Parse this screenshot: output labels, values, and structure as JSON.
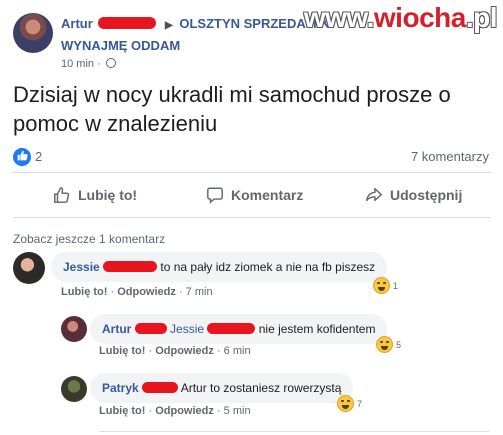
{
  "post": {
    "author": "Artur",
    "group_line1": "OLSZTYN SPRZEDAM K",
    "group_line2": "WYNAJMĘ ODDAM",
    "time": "10 min",
    "text": "Dzisiaj w nocy ukradli mi samochud prosze o pomoc w znalezieniu",
    "like_count": "2",
    "comment_count": "7 komentarzy",
    "watermark_a": "www.",
    "watermark_b": "wiocha",
    "watermark_c": ".pl"
  },
  "actions": {
    "like": "Lubię to!",
    "comment": "Komentarz",
    "share": "Udostępnij"
  },
  "comments_section": {
    "more_link": "Zobacz jeszcze 1 komentarz",
    "items": [
      {
        "author": "Jessie",
        "text": "to na pały idz ziomek a nie na fb piszesz",
        "like": "Lubię to!",
        "reply": "Odpowiedz",
        "time": "7 min",
        "reaction_count": "1"
      },
      {
        "author": "Artur",
        "tagged": "Jessie",
        "text": "nie jestem kofidentem",
        "like": "Lubię to!",
        "reply": "Odpowiedz",
        "time": "6 min",
        "reaction_count": "5"
      },
      {
        "author": "Patryk",
        "text": "Artur to zostaniesz rowerzystą",
        "like": "Lubię to!",
        "reply": "Odpowiedz",
        "time": "5 min",
        "reaction_count": "7"
      }
    ]
  },
  "colors": {
    "link_blue": "#385898",
    "like_blue": "#2078f4",
    "redaction_red": "#e8141f"
  }
}
